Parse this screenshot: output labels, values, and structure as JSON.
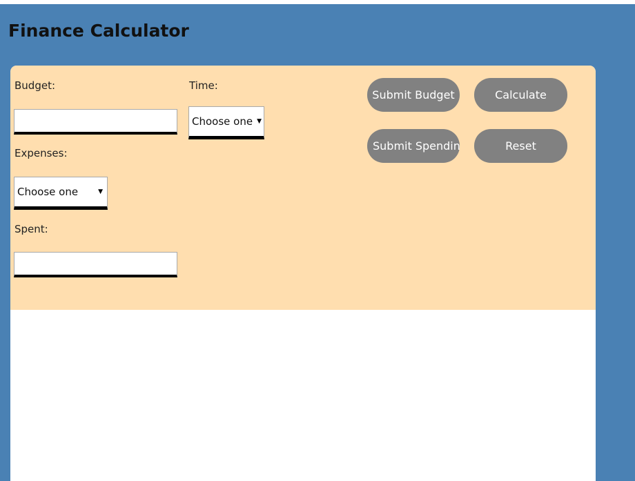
{
  "app": {
    "title": "Finance Calculator"
  },
  "form": {
    "budget_label": "Budget:",
    "budget_value": "",
    "expenses_label": "Expenses:",
    "expenses_selected": "Choose one",
    "spent_label": "Spent:",
    "spent_value": "",
    "time_label": "Time:",
    "time_selected": "Choose one"
  },
  "buttons": {
    "submit_budget": "Submit Budget",
    "calculate": "Calculate",
    "submit_spending": "Submit Spending",
    "reset": "Reset"
  },
  "colors": {
    "page_background": "#4a81b4",
    "form_background": "#ffdeaf",
    "button_background": "#818181",
    "button_text": "#ffffff"
  },
  "icons": {
    "dropdown": "triangle-down-icon"
  }
}
